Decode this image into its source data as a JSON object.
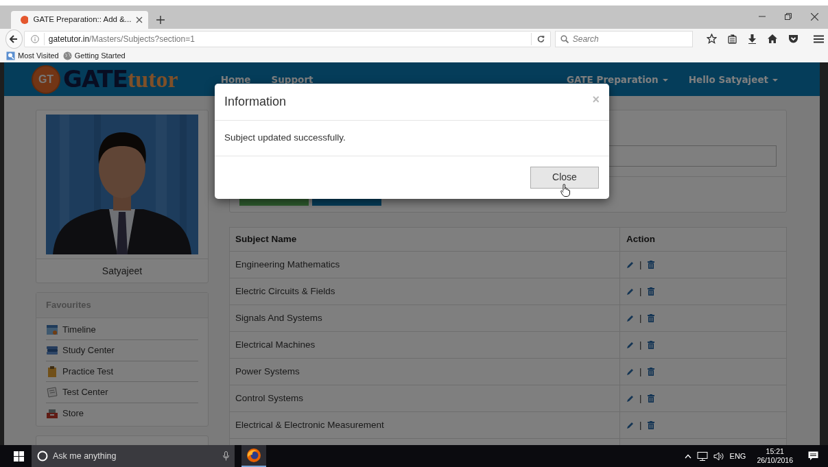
{
  "browser": {
    "tab_title": "GATE Preparation:: Add &...",
    "url_host": "gatetutor.in",
    "url_path": "/Masters/Subjects?section=1",
    "search_placeholder": "Search",
    "bookmarks": [
      {
        "label": "Most Visited",
        "kind": "folder"
      },
      {
        "label": "Getting Started",
        "kind": "globe"
      }
    ]
  },
  "site": {
    "logo": {
      "badge": "GT",
      "main": "GATE",
      "accent": "tutor"
    },
    "nav": [
      "Home",
      "Support"
    ],
    "menus": [
      "GATE Preparation",
      "Hello Satyajeet"
    ],
    "profile": {
      "name": "Satyajeet"
    },
    "favourites": {
      "title": "Favourites",
      "items": [
        {
          "label": "Timeline",
          "kind": "calendar"
        },
        {
          "label": "Study Center",
          "kind": "books"
        },
        {
          "label": "Practice Test",
          "kind": "clipboard"
        },
        {
          "label": "Test Center",
          "kind": "paper"
        },
        {
          "label": "Store",
          "kind": "register"
        }
      ]
    },
    "form_buttons": [
      {
        "kind": "add"
      },
      {
        "kind": "cancel"
      }
    ],
    "table": {
      "columns": [
        "Subject Name",
        "Action"
      ],
      "rows": [
        {
          "name": "Engineering Mathematics",
          "separator": "|"
        },
        {
          "name": "Electric Circuits & Fields",
          "separator": "|"
        },
        {
          "name": "Signals And Systems",
          "separator": "|"
        },
        {
          "name": "Electrical Machines",
          "separator": "|"
        },
        {
          "name": "Power Systems",
          "separator": "|"
        },
        {
          "name": "Control Systems",
          "separator": "|"
        },
        {
          "name": "Electrical & Electronic Measurement",
          "separator": "|"
        }
      ]
    }
  },
  "modal": {
    "title": "Information",
    "dismiss": "×",
    "message": "Subject updated successfully.",
    "button": "Close"
  },
  "taskbar": {
    "search_placeholder": "Ask me anything",
    "language": "ENG",
    "time": "15:21",
    "date": "26/10/2016"
  }
}
